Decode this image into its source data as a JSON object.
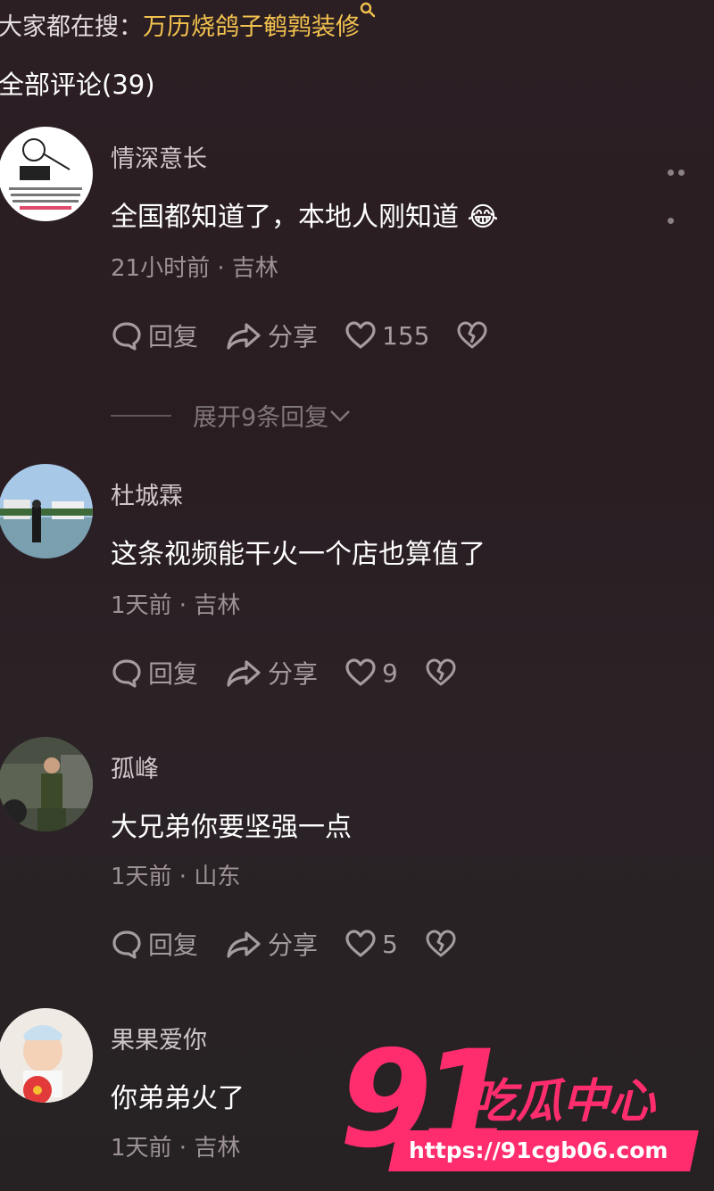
{
  "search_hint": {
    "prefix": "大家都在搜：",
    "keyword": "万历烧鸽子鹌鹑装修"
  },
  "comments_header": "全部评论(39)",
  "action_labels": {
    "reply": "回复",
    "share": "分享"
  },
  "comments": [
    {
      "username": "情深意长",
      "text": "全国都知道了，本地人刚知道",
      "emoji": "😂",
      "time": "21小时前",
      "location": "吉林",
      "likes": "155",
      "expand_replies": "展开9条回复"
    },
    {
      "username": "杜城霖",
      "text": "这条视频能干火一个店也算值了",
      "time": "1天前",
      "location": "吉林",
      "likes": "9"
    },
    {
      "username": "孤峰",
      "text": "大兄弟你要坚强一点",
      "time": "1天前",
      "location": "山东",
      "likes": "5"
    },
    {
      "username": "果果爱你",
      "text": "你弟弟火了",
      "time": "1天前",
      "location": "吉林"
    }
  ],
  "watermark": {
    "number": "91",
    "name": "吃瓜中心",
    "url": "https://91cgb06.com"
  },
  "colors": {
    "accent_keyword": "#f2c14e",
    "watermark": "#ff2d6e"
  }
}
